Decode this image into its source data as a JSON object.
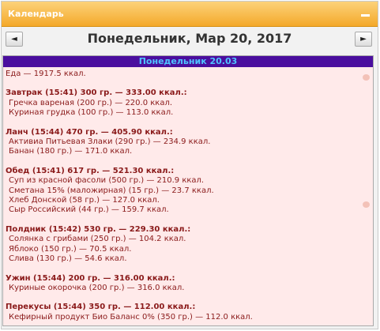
{
  "window": {
    "title": "Календарь"
  },
  "nav": {
    "prev": "◄",
    "next": "►",
    "date": "Понедельник, Мар 20, 2017"
  },
  "day": {
    "header": "Понедельник 20.03",
    "total": "Еда — 1917.5 ккал.",
    "meals": [
      {
        "title": "Завтрак (15:41) 300 гр. — 333.00 ккал.:",
        "items": [
          "Гречка вареная (200 гр.) — 220.0 ккал.",
          "Куриная грудка (100 гр.) — 113.0 ккал."
        ]
      },
      {
        "title": "Ланч (15:44) 470 гр. — 405.90 ккал.:",
        "items": [
          "Активиа Питьевая Злаки (290 гр.) — 234.9 ккал.",
          "Банан (180 гр.) — 171.0 ккал."
        ]
      },
      {
        "title": "Обед (15:41) 617 гр. — 521.30 ккал.:",
        "items": [
          "Суп из красной фасоли (500 гр.) — 210.9 ккал.",
          "Сметана 15% (маложирная) (15 гр.) — 23.7 ккал.",
          "Хлеб Донской (58 гр.) — 127.0 ккал.",
          "Сыр Российский (44 гр.) — 159.7 ккал."
        ]
      },
      {
        "title": "Полдник (15:42) 530 гр. — 229.30 ккал.:",
        "items": [
          "Солянка с грибами (250 гр.) — 104.2 ккал.",
          "Яблоко (150 гр.) — 70.5 ккал.",
          "Слива (130 гр.) — 54.6 ккал."
        ]
      },
      {
        "title": "Ужин (15:44) 200 гр. — 316.00 ккал.:",
        "items": [
          "Куриные окорочка (200 гр.) — 316.0 ккал."
        ]
      },
      {
        "title": "Перекусы (15:44) 350 гр. — 112.00 ккал.:",
        "items": [
          "Кефирный продукт Био Баланс 0% (350 гр.) — 112.0 ккал."
        ]
      }
    ]
  },
  "icons": {
    "minimize": "minimize-icon",
    "prev": "arrow-left-icon",
    "next": "arrow-right-icon",
    "drag": "drag-handle-icon"
  }
}
